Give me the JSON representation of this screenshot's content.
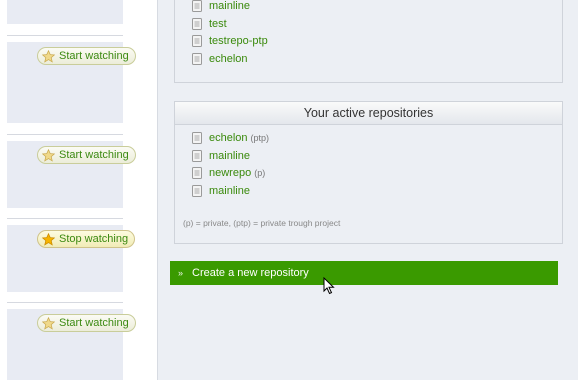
{
  "watch_cards": [
    {
      "label": "Start watching",
      "state": "inactive"
    },
    {
      "label": "Start watching",
      "state": "inactive"
    },
    {
      "label": "Stop watching",
      "state": "active"
    },
    {
      "label": "Start watching",
      "state": "inactive"
    }
  ],
  "top_panel": {
    "repos": [
      {
        "name": "mainline"
      },
      {
        "name": "test"
      },
      {
        "name": "testrepo-ptp"
      },
      {
        "name": "echelon"
      }
    ]
  },
  "active_panel": {
    "title": "Your active repositories",
    "repos": [
      {
        "name": "echelon",
        "tag": "(ptp)"
      },
      {
        "name": "mainline",
        "tag": ""
      },
      {
        "name": "newrepo",
        "tag": "(p)"
      },
      {
        "name": "mainline",
        "tag": ""
      }
    ],
    "legend": "(p) = private, (ptp) = private trough project"
  },
  "create_repo": {
    "label": "Create a new repository",
    "arrow": "»"
  },
  "icons": {
    "watch": "star-icon",
    "repo": "file-icon",
    "pointer": "mouse-cursor-icon"
  },
  "colors": {
    "link_green": "#3a8a0c",
    "action_green": "#3a9a00",
    "card_bg": "#e8ebf3",
    "panel_bg": "#eceff4"
  }
}
